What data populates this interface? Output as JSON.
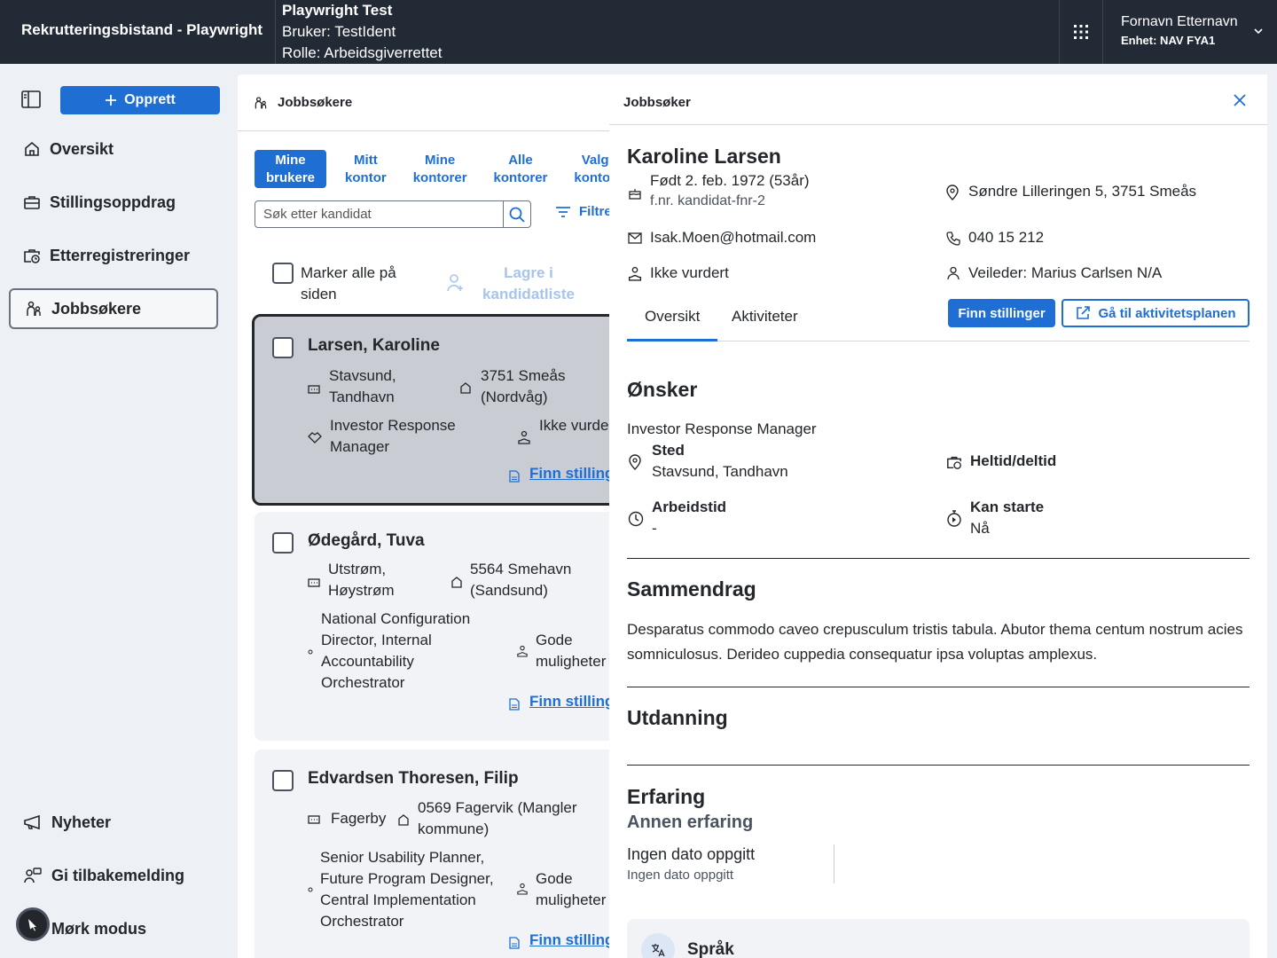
{
  "header": {
    "app_title": "Rekrutteringsbistand - Playwright",
    "test_title": "Playwright Test",
    "test_user": "Bruker: TestIdent",
    "test_role": "Rolle: Arbeidsgiverrettet",
    "user_name": "Fornavn Etternavn",
    "user_unit": "Enhet: NAV FYA1"
  },
  "sidebar": {
    "create_label": "Opprett",
    "items": [
      {
        "label": "Oversikt",
        "icon": "house-icon"
      },
      {
        "label": "Stillingsoppdrag",
        "icon": "briefcase-icon"
      },
      {
        "label": "Etterregistreringer",
        "icon": "briefcase-clock-icon"
      },
      {
        "label": "Jobbsøkere",
        "icon": "people-icon"
      }
    ],
    "bottom_items": [
      {
        "label": "Nyheter",
        "icon": "megaphone-icon"
      },
      {
        "label": "Gi tilbakemelding",
        "icon": "person-chat-icon"
      },
      {
        "label": "Mørk modus",
        "icon": "moon-icon"
      }
    ]
  },
  "list_panel": {
    "title": "Jobbsøkere",
    "scope_tabs": [
      {
        "line1": "Mine",
        "line2": "brukere"
      },
      {
        "line1": "Mitt",
        "line2": "kontor"
      },
      {
        "line1": "Mine",
        "line2": "kontorer"
      },
      {
        "line1": "Alle",
        "line2": "kontorer"
      },
      {
        "line1": "Valgte",
        "line2": "kontorer"
      }
    ],
    "search_placeholder": "Søk etter kandidat",
    "filter_label": "Filtre",
    "mark_all_label": "Marker alle på siden",
    "save_list_label": "Lagre i kandidatliste",
    "candidates": [
      {
        "name": "Larsen, Karoline",
        "location": "Stavsund, Tandhavn",
        "address": "3751 Smeås (Nordvåg)",
        "job": "Investor Response Manager",
        "assessment": "Ikke vurdert",
        "link": "Finn stillinger"
      },
      {
        "name": "Ødegård, Tuva",
        "location": "Utstrøm, Høystrøm",
        "address": "5564 Smehavn (Sandsund)",
        "job": "National Configuration Director, Internal Accountability Orchestrator",
        "assessment": "Gode muligheter",
        "link": "Finn stillinger"
      },
      {
        "name": "Edvardsen Thoresen, Filip",
        "location": "Fagerby",
        "address": "0569 Fagervik (Mangler kommune)",
        "job": "Senior Usability Planner, Future Program Designer, Central Implementation Orchestrator",
        "assessment": "Gode muligheter",
        "link": "Finn stillinger"
      }
    ]
  },
  "detail": {
    "panel_title": "Jobbsøker",
    "name": "Karoline Larsen",
    "born": "Født 2. feb. 1972 (53år)",
    "fnr": "f.nr. kandidat-fnr-2",
    "address": "Søndre Lilleringen 5, 3751 Smeås",
    "email": "Isak.Moen@hotmail.com",
    "phone": "040 15 212",
    "assessment": "Ikke vurdert",
    "advisor": "Veileder: Marius Carlsen N/A",
    "tabs": [
      "Oversikt",
      "Aktiviteter"
    ],
    "btn_find": "Finn stillinger",
    "btn_plan": "Gå til aktivitetsplanen",
    "wishes": {
      "title": "Ønsker",
      "job": "Investor Response Manager",
      "place_label": "Sted",
      "place_value": "Stavsund, Tandhavn",
      "hours_label": "Heltid/deltid",
      "worktime_label": "Arbeidstid",
      "worktime_value": "-",
      "start_label": "Kan starte",
      "start_value": "Nå"
    },
    "summary_title": "Sammendrag",
    "summary_text": "Desparatus commodo caveo crepusculum tristis tabula. Abutor thema centum nostrum acies somniculosus. Derideo cuppedia consequatur ipsa voluptas amplexus.",
    "education_title": "Utdanning",
    "experience_title": "Erfaring",
    "experience_sub": "Annen erfaring",
    "experience_date1": "Ingen dato oppgitt",
    "experience_date2": "Ingen dato oppgitt",
    "language_title": "Språk"
  },
  "colors": {
    "header_bg": "#222a35",
    "accent": "#1f6ed4",
    "page_bg": "#edf0f4"
  }
}
